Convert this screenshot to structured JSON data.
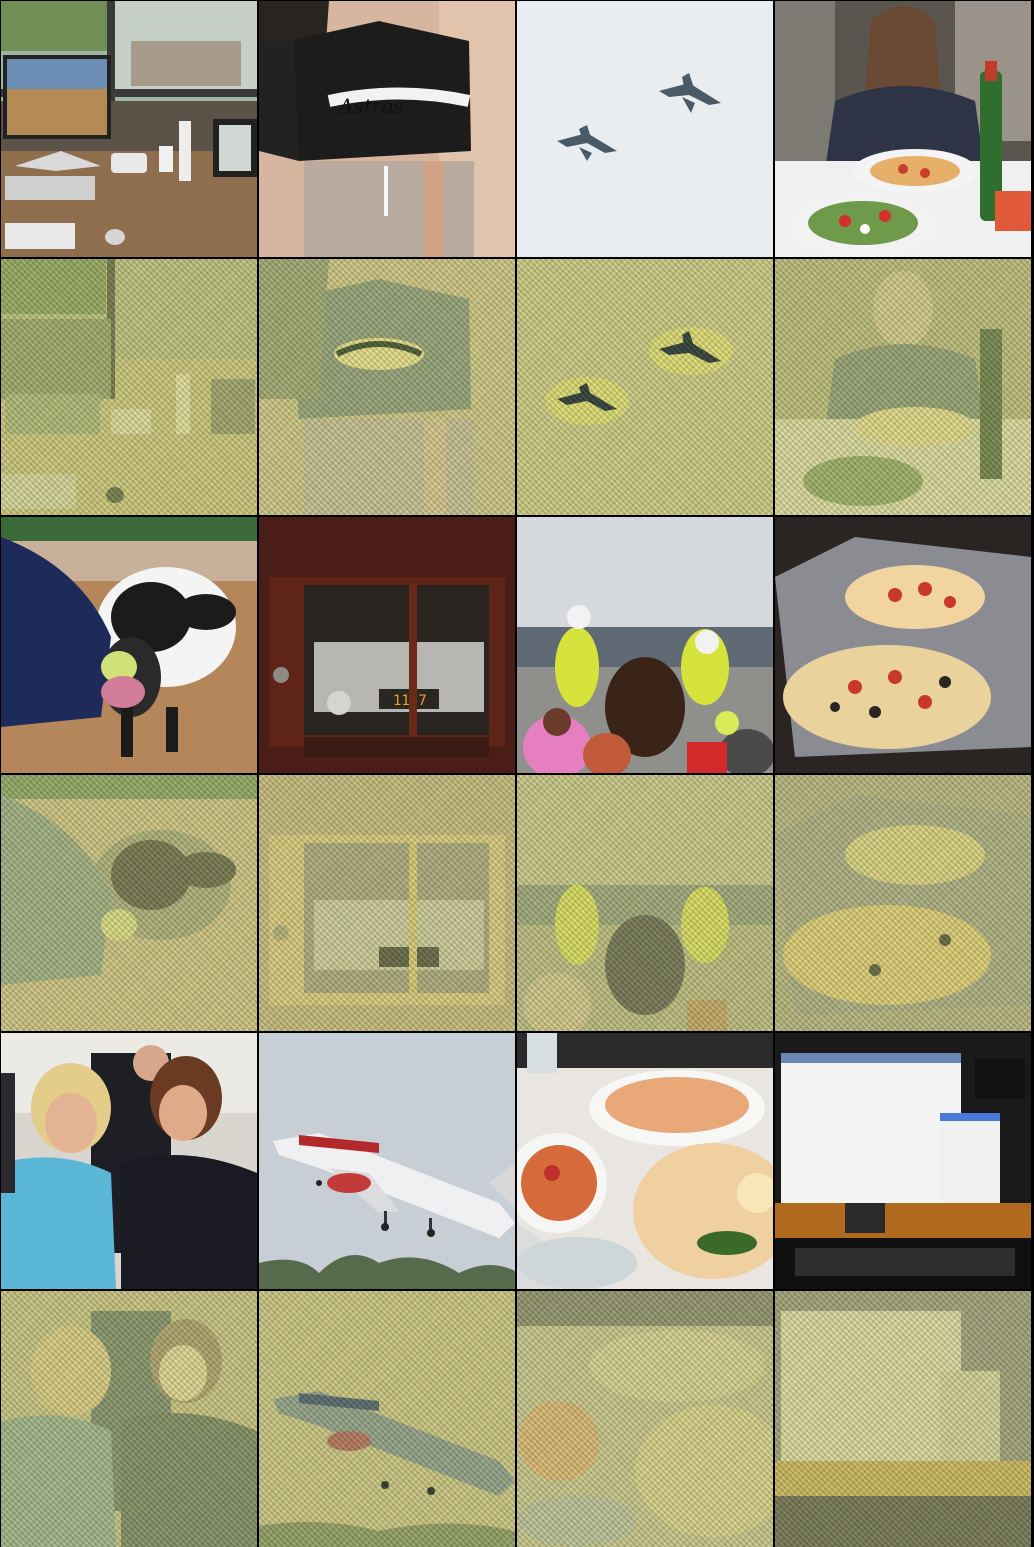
{
  "grid": {
    "columns": 4,
    "rows": 6
  },
  "clock_readout": "1157",
  "jersey_text": "Astros",
  "tiles": [
    {
      "name": "tile-desk-computer-original"
    },
    {
      "name": "tile-baseball-jersey-original"
    },
    {
      "name": "tile-fighter-jets-original"
    },
    {
      "name": "tile-woman-dinner-original"
    },
    {
      "name": "tile-desk-computer-reconstruction"
    },
    {
      "name": "tile-baseball-jersey-reconstruction"
    },
    {
      "name": "tile-fighter-jets-reconstruction"
    },
    {
      "name": "tile-woman-dinner-reconstruction"
    },
    {
      "name": "tile-cow-apple-original"
    },
    {
      "name": "tile-cabinet-vcr-original"
    },
    {
      "name": "tile-mounted-police-original"
    },
    {
      "name": "tile-pizza-foil-original"
    },
    {
      "name": "tile-cow-apple-reconstruction"
    },
    {
      "name": "tile-cabinet-vcr-reconstruction"
    },
    {
      "name": "tile-mounted-police-reconstruction"
    },
    {
      "name": "tile-pizza-foil-reconstruction"
    },
    {
      "name": "tile-two-women-original"
    },
    {
      "name": "tile-airliner-original"
    },
    {
      "name": "tile-pizza-table-original"
    },
    {
      "name": "tile-computer-monitor-original"
    },
    {
      "name": "tile-two-women-reconstruction"
    },
    {
      "name": "tile-airliner-reconstruction"
    },
    {
      "name": "tile-pizza-table-reconstruction"
    },
    {
      "name": "tile-computer-monitor-reconstruction"
    }
  ]
}
